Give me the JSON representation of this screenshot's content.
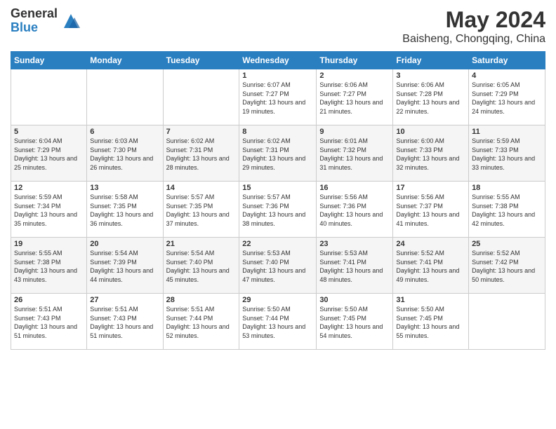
{
  "app": {
    "logo_line1": "General",
    "logo_line2": "Blue"
  },
  "header": {
    "title": "May 2024",
    "subtitle": "Baisheng, Chongqing, China"
  },
  "weekdays": [
    "Sunday",
    "Monday",
    "Tuesday",
    "Wednesday",
    "Thursday",
    "Friday",
    "Saturday"
  ],
  "weeks": [
    [
      {
        "day": "",
        "sunrise": "",
        "sunset": "",
        "daylight": ""
      },
      {
        "day": "",
        "sunrise": "",
        "sunset": "",
        "daylight": ""
      },
      {
        "day": "",
        "sunrise": "",
        "sunset": "",
        "daylight": ""
      },
      {
        "day": "1",
        "sunrise": "Sunrise: 6:07 AM",
        "sunset": "Sunset: 7:27 PM",
        "daylight": "Daylight: 13 hours and 19 minutes."
      },
      {
        "day": "2",
        "sunrise": "Sunrise: 6:06 AM",
        "sunset": "Sunset: 7:27 PM",
        "daylight": "Daylight: 13 hours and 21 minutes."
      },
      {
        "day": "3",
        "sunrise": "Sunrise: 6:06 AM",
        "sunset": "Sunset: 7:28 PM",
        "daylight": "Daylight: 13 hours and 22 minutes."
      },
      {
        "day": "4",
        "sunrise": "Sunrise: 6:05 AM",
        "sunset": "Sunset: 7:29 PM",
        "daylight": "Daylight: 13 hours and 24 minutes."
      }
    ],
    [
      {
        "day": "5",
        "sunrise": "Sunrise: 6:04 AM",
        "sunset": "Sunset: 7:29 PM",
        "daylight": "Daylight: 13 hours and 25 minutes."
      },
      {
        "day": "6",
        "sunrise": "Sunrise: 6:03 AM",
        "sunset": "Sunset: 7:30 PM",
        "daylight": "Daylight: 13 hours and 26 minutes."
      },
      {
        "day": "7",
        "sunrise": "Sunrise: 6:02 AM",
        "sunset": "Sunset: 7:31 PM",
        "daylight": "Daylight: 13 hours and 28 minutes."
      },
      {
        "day": "8",
        "sunrise": "Sunrise: 6:02 AM",
        "sunset": "Sunset: 7:31 PM",
        "daylight": "Daylight: 13 hours and 29 minutes."
      },
      {
        "day": "9",
        "sunrise": "Sunrise: 6:01 AM",
        "sunset": "Sunset: 7:32 PM",
        "daylight": "Daylight: 13 hours and 31 minutes."
      },
      {
        "day": "10",
        "sunrise": "Sunrise: 6:00 AM",
        "sunset": "Sunset: 7:33 PM",
        "daylight": "Daylight: 13 hours and 32 minutes."
      },
      {
        "day": "11",
        "sunrise": "Sunrise: 5:59 AM",
        "sunset": "Sunset: 7:33 PM",
        "daylight": "Daylight: 13 hours and 33 minutes."
      }
    ],
    [
      {
        "day": "12",
        "sunrise": "Sunrise: 5:59 AM",
        "sunset": "Sunset: 7:34 PM",
        "daylight": "Daylight: 13 hours and 35 minutes."
      },
      {
        "day": "13",
        "sunrise": "Sunrise: 5:58 AM",
        "sunset": "Sunset: 7:35 PM",
        "daylight": "Daylight: 13 hours and 36 minutes."
      },
      {
        "day": "14",
        "sunrise": "Sunrise: 5:57 AM",
        "sunset": "Sunset: 7:35 PM",
        "daylight": "Daylight: 13 hours and 37 minutes."
      },
      {
        "day": "15",
        "sunrise": "Sunrise: 5:57 AM",
        "sunset": "Sunset: 7:36 PM",
        "daylight": "Daylight: 13 hours and 38 minutes."
      },
      {
        "day": "16",
        "sunrise": "Sunrise: 5:56 AM",
        "sunset": "Sunset: 7:36 PM",
        "daylight": "Daylight: 13 hours and 40 minutes."
      },
      {
        "day": "17",
        "sunrise": "Sunrise: 5:56 AM",
        "sunset": "Sunset: 7:37 PM",
        "daylight": "Daylight: 13 hours and 41 minutes."
      },
      {
        "day": "18",
        "sunrise": "Sunrise: 5:55 AM",
        "sunset": "Sunset: 7:38 PM",
        "daylight": "Daylight: 13 hours and 42 minutes."
      }
    ],
    [
      {
        "day": "19",
        "sunrise": "Sunrise: 5:55 AM",
        "sunset": "Sunset: 7:38 PM",
        "daylight": "Daylight: 13 hours and 43 minutes."
      },
      {
        "day": "20",
        "sunrise": "Sunrise: 5:54 AM",
        "sunset": "Sunset: 7:39 PM",
        "daylight": "Daylight: 13 hours and 44 minutes."
      },
      {
        "day": "21",
        "sunrise": "Sunrise: 5:54 AM",
        "sunset": "Sunset: 7:40 PM",
        "daylight": "Daylight: 13 hours and 45 minutes."
      },
      {
        "day": "22",
        "sunrise": "Sunrise: 5:53 AM",
        "sunset": "Sunset: 7:40 PM",
        "daylight": "Daylight: 13 hours and 47 minutes."
      },
      {
        "day": "23",
        "sunrise": "Sunrise: 5:53 AM",
        "sunset": "Sunset: 7:41 PM",
        "daylight": "Daylight: 13 hours and 48 minutes."
      },
      {
        "day": "24",
        "sunrise": "Sunrise: 5:52 AM",
        "sunset": "Sunset: 7:41 PM",
        "daylight": "Daylight: 13 hours and 49 minutes."
      },
      {
        "day": "25",
        "sunrise": "Sunrise: 5:52 AM",
        "sunset": "Sunset: 7:42 PM",
        "daylight": "Daylight: 13 hours and 50 minutes."
      }
    ],
    [
      {
        "day": "26",
        "sunrise": "Sunrise: 5:51 AM",
        "sunset": "Sunset: 7:43 PM",
        "daylight": "Daylight: 13 hours and 51 minutes."
      },
      {
        "day": "27",
        "sunrise": "Sunrise: 5:51 AM",
        "sunset": "Sunset: 7:43 PM",
        "daylight": "Daylight: 13 hours and 51 minutes."
      },
      {
        "day": "28",
        "sunrise": "Sunrise: 5:51 AM",
        "sunset": "Sunset: 7:44 PM",
        "daylight": "Daylight: 13 hours and 52 minutes."
      },
      {
        "day": "29",
        "sunrise": "Sunrise: 5:50 AM",
        "sunset": "Sunset: 7:44 PM",
        "daylight": "Daylight: 13 hours and 53 minutes."
      },
      {
        "day": "30",
        "sunrise": "Sunrise: 5:50 AM",
        "sunset": "Sunset: 7:45 PM",
        "daylight": "Daylight: 13 hours and 54 minutes."
      },
      {
        "day": "31",
        "sunrise": "Sunrise: 5:50 AM",
        "sunset": "Sunset: 7:45 PM",
        "daylight": "Daylight: 13 hours and 55 minutes."
      },
      {
        "day": "",
        "sunrise": "",
        "sunset": "",
        "daylight": ""
      }
    ]
  ]
}
